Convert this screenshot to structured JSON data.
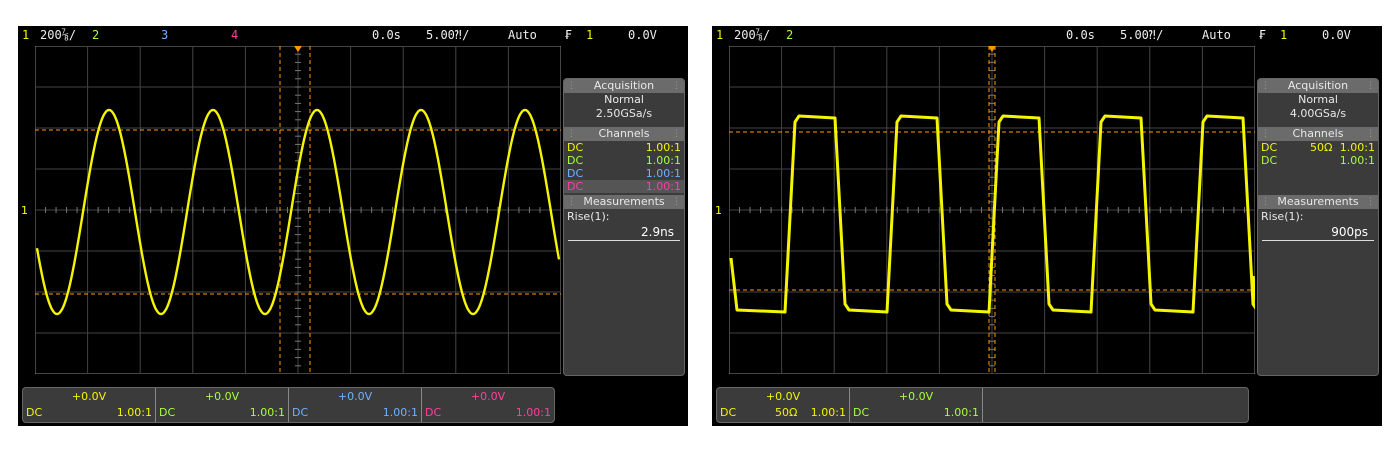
{
  "colors": {
    "ch1": "#f5f500",
    "ch2": "#a8ff3c",
    "ch3": "#6fb1ff",
    "ch4": "#ff3fa0",
    "cursor": "#ff9900",
    "grid": "#555555"
  },
  "scope_a": {
    "topbar": {
      "ch1_num": "1",
      "ch1_scale": "200⅞/",
      "ch2_num": "2",
      "ch3_num": "3",
      "ch4_num": "4",
      "time_pos": "0.0s",
      "time_scale": "5.00⁈/",
      "mode": "Auto",
      "trig_icon": "₣",
      "trig_ch": "1",
      "trig_level": "0.0V"
    },
    "panel": {
      "acq_title": "Acquisition",
      "acq_mode": "Normal",
      "acq_rate": "2.50GSa/s",
      "ch_title": "Channels",
      "channels": [
        {
          "coupling": "DC",
          "impedance": "",
          "probe": "1.00:1"
        },
        {
          "coupling": "DC",
          "impedance": "",
          "probe": "1.00:1"
        },
        {
          "coupling": "DC",
          "impedance": "",
          "probe": "1.00:1"
        },
        {
          "coupling": "DC",
          "impedance": "",
          "probe": "1.00:1"
        }
      ],
      "meas_title": "Measurements",
      "meas_name": "Rise(1):",
      "meas_value": "2.9ns"
    },
    "bottom": [
      {
        "offset": "+0.0V",
        "coupling": "DC",
        "impedance": "",
        "probe": "1.00:1"
      },
      {
        "offset": "+0.0V",
        "coupling": "DC",
        "impedance": "",
        "probe": "1.00:1"
      },
      {
        "offset": "+0.0V",
        "coupling": "DC",
        "impedance": "",
        "probe": "1.00:1"
      },
      {
        "offset": "+0.0V",
        "coupling": "DC",
        "impedance": "",
        "probe": "1.00:1"
      }
    ],
    "ground_marker": "1"
  },
  "scope_b": {
    "topbar": {
      "ch1_num": "1",
      "ch1_scale": "200⅞/",
      "ch2_num": "2",
      "time_pos": "0.0s",
      "time_scale": "5.00⁈/",
      "mode": "Auto",
      "trig_icon": "₣",
      "trig_ch": "1",
      "trig_level": "0.0V"
    },
    "panel": {
      "acq_title": "Acquisition",
      "acq_mode": "Normal",
      "acq_rate": "4.00GSa/s",
      "ch_title": "Channels",
      "channels": [
        {
          "coupling": "DC",
          "impedance": "50Ω",
          "probe": "1.00:1"
        },
        {
          "coupling": "DC",
          "impedance": "",
          "probe": "1.00:1"
        }
      ],
      "meas_title": "Measurements",
      "meas_name": "Rise(1):",
      "meas_value": "900ps"
    },
    "bottom": [
      {
        "offset": "+0.0V",
        "coupling": "DC",
        "impedance": "50Ω",
        "probe": "1.00:1"
      },
      {
        "offset": "+0.0V",
        "coupling": "DC",
        "impedance": "",
        "probe": "1.00:1"
      }
    ],
    "ground_marker": "1"
  }
}
